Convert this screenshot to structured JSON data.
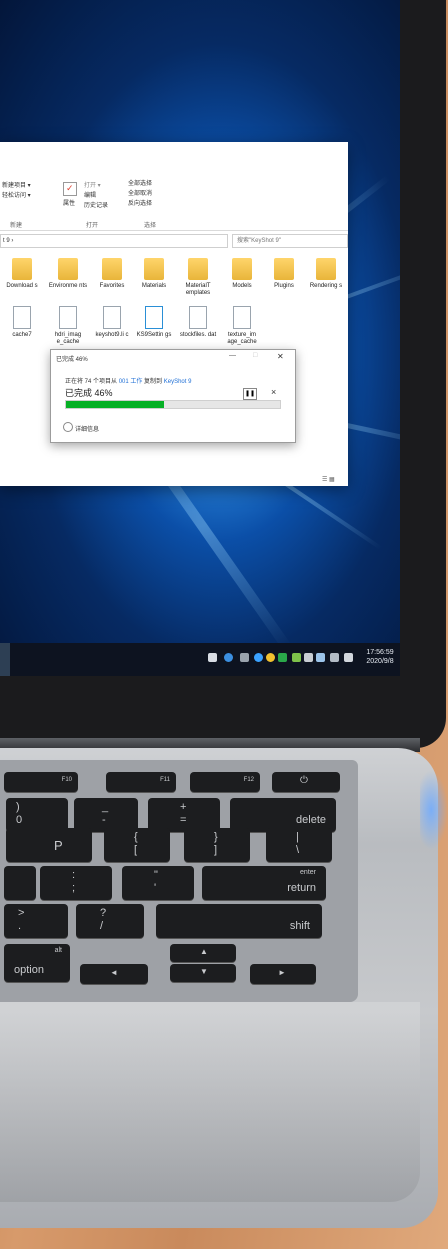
{
  "explorer": {
    "ribbon": {
      "new_item": "新建项目 ▾",
      "easy_access": "轻松访问 ▾",
      "group_new": "新建",
      "properties": "属性",
      "open": "打开 ▾",
      "edit": "编辑",
      "history": "历史记录",
      "group_open": "打开",
      "select_all": "全部选择",
      "select_none": "全部取消",
      "invert_selection": "反向选择",
      "group_select": "选择"
    },
    "address": "t 9  ›",
    "search_placeholder": "搜索\"KeyShot 9\"",
    "row1": [
      "Download s",
      "Environme nts",
      "Favorites",
      "Materials",
      "MaterialT emplates",
      "Models",
      "Plugins",
      "Rendering s"
    ],
    "row2": [
      "cache7",
      "hdri_imag e_cache",
      "keyshot9.li c",
      "KS9Settin gs",
      "stockfiles. dat",
      "texture_im age_cache"
    ],
    "status_right": "☰ ▦"
  },
  "dialog": {
    "title": "已完成 46%",
    "copy_line_prefix": "正在将 74 个项目从",
    "copy_src": "001 工作",
    "copy_mid": "复制到",
    "copy_dst": "KeyShot 9",
    "percent_label": "已完成 46%",
    "progress": 0.46,
    "pause": "❚❚",
    "cancel": "×",
    "details": "详细信息"
  },
  "taskbar": {
    "time": "17:56:59",
    "date": "2020/9/8"
  },
  "keyboard": {
    "fn_f10": "F10",
    "fn_f11": "F11",
    "fn_f12": "F12",
    "power": "⏻",
    "zero": "0",
    "close_paren": ")",
    "underscore": "_",
    "minus": "-",
    "plus": "+",
    "equals": "=",
    "delete": "delete",
    "p": "P",
    "left_brace": "{",
    "left_bracket": "[",
    "right_brace": "}",
    "right_bracket": "]",
    "pipe": "|",
    "backslash": "\\",
    "colon": ":",
    "semicolon": ";",
    "dquote": "\"",
    "squote": "'",
    "enter": "enter",
    "return": "return",
    "gt": ">",
    "period": ".",
    "question": "?",
    "slash": "/",
    "shift": "shift",
    "alt": "alt",
    "option": "option",
    "arrow_left": "◄",
    "arrow_up": "▲",
    "arrow_down": "▼",
    "arrow_right": "►"
  }
}
